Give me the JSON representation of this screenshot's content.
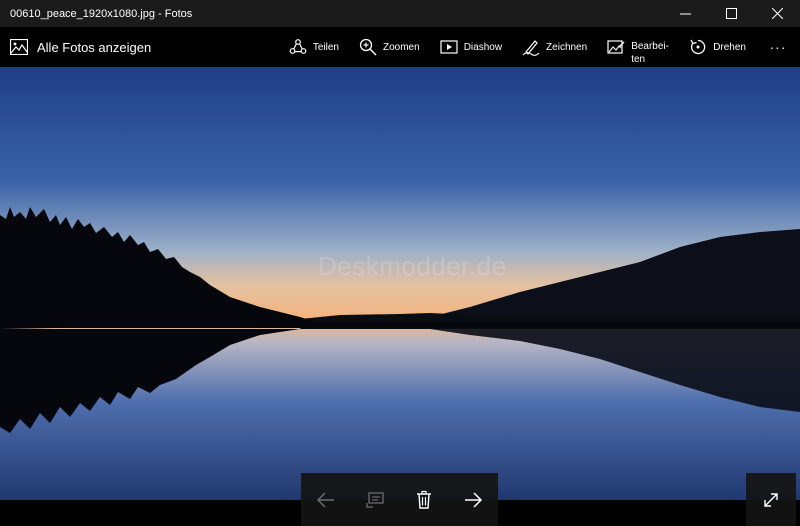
{
  "window": {
    "title": "00610_peace_1920x1080.jpg - Fotos",
    "controls": [
      "minimize",
      "maximize",
      "close"
    ]
  },
  "commandbar": {
    "back_label": "Alle Fotos anzeigen",
    "back_icon": "photo-gallery-icon",
    "commands": [
      {
        "label": "Teilen",
        "icon": "share-icon"
      },
      {
        "label": "Zoomen",
        "icon": "zoom-icon"
      },
      {
        "label": "Diashow",
        "icon": "slideshow-icon"
      },
      {
        "label": "Zeichnen",
        "icon": "draw-icon"
      },
      {
        "label": "Bearbei-\nten",
        "icon": "edit-icon"
      },
      {
        "label": "Drehen",
        "icon": "rotate-icon"
      }
    ],
    "more_label": "···"
  },
  "photo": {
    "subject": "lake at dusk with forest silhouette",
    "watermark": "Deskmodder.de"
  },
  "navigation": {
    "buttons": [
      {
        "icon": "arrow-left-icon",
        "enabled": false
      },
      {
        "icon": "compare-icon",
        "enabled": false
      },
      {
        "icon": "trash-icon",
        "enabled": true
      },
      {
        "icon": "arrow-right-icon",
        "enabled": true
      }
    ],
    "fullscreen_icon": "fullscreen-icon"
  },
  "colors": {
    "titlebar_bg": "#1b1b1b",
    "commandbar_bg": "#000000",
    "sky_top": "#1f3f86",
    "horizon": "#f2b884"
  }
}
